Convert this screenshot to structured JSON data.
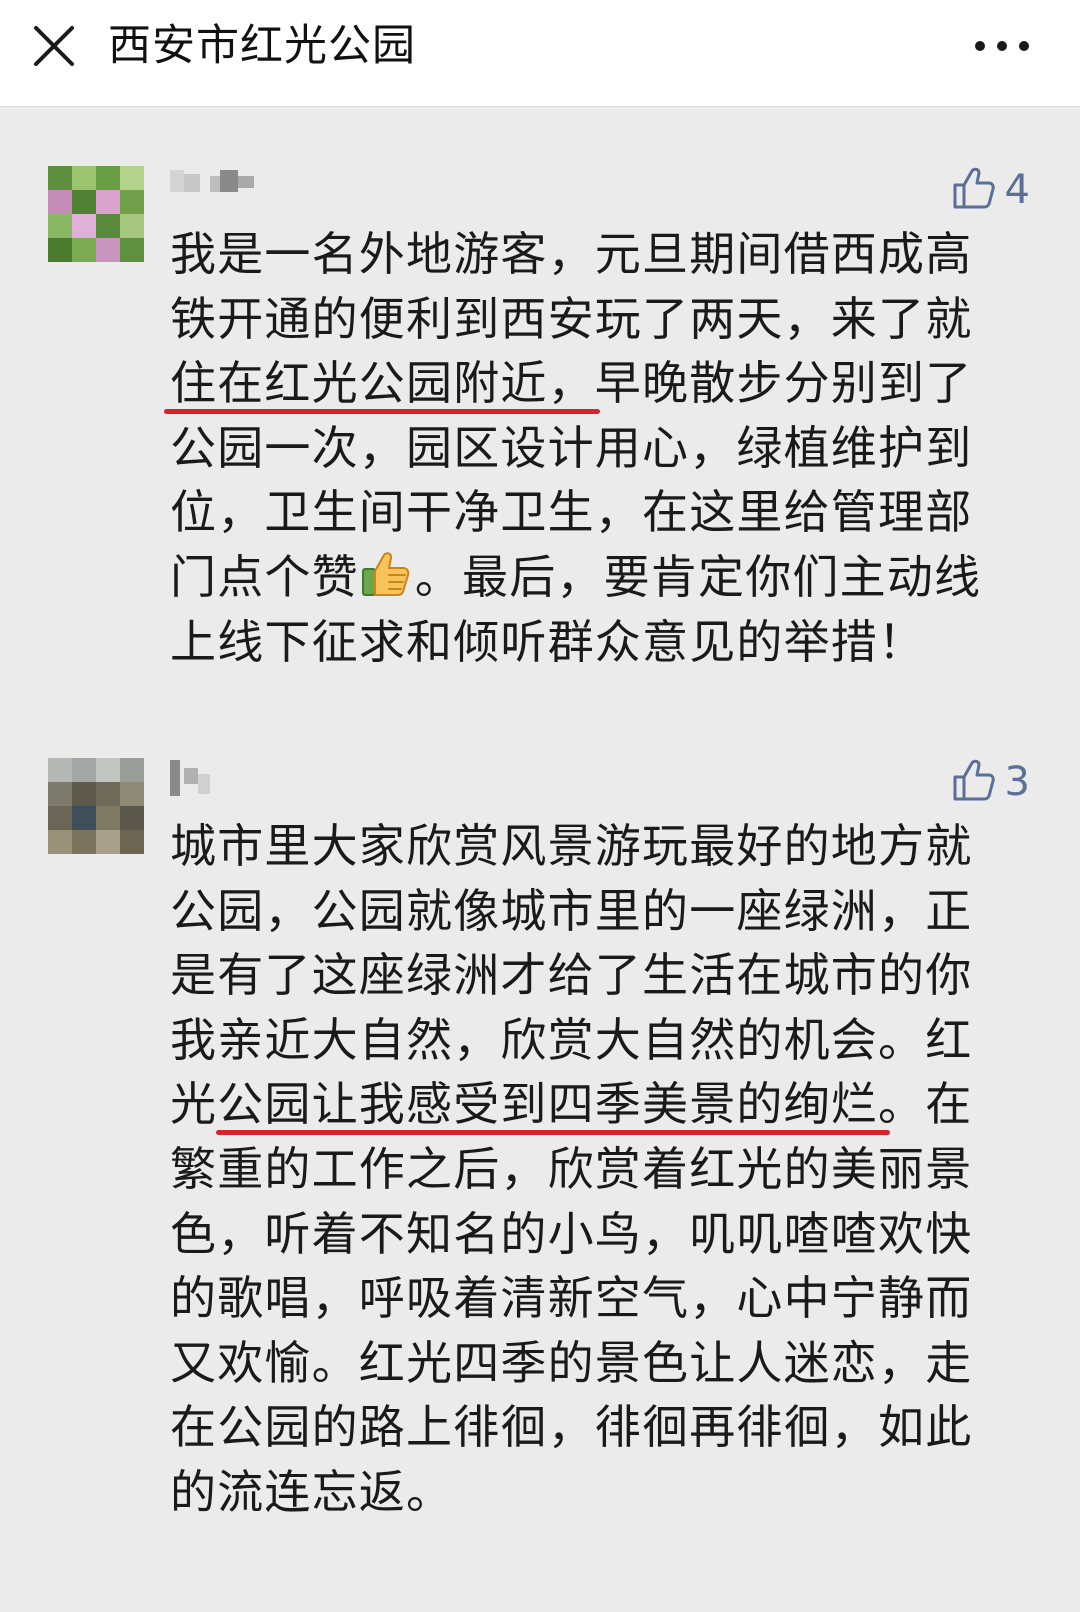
{
  "nav": {
    "title": "西安市红光公园",
    "close_icon": "close-icon",
    "more_icon": "more-icon"
  },
  "comments": [
    {
      "avatar_icon": "avatar",
      "likes": "4",
      "text": "我是一名外地游客，元旦期间借西成高\n铁开通的便利到西安玩了两天，来了就\n住在红光公园附近，早晚散步分别到了\n公园一次，园区设计用心，绿植维护到\n位，卫生间干净卫生，在这里给管理部\n门点个赞",
      "text_after_emoji": "。最后，要肯定你们主动线\n上线下征求和倾听群众意见的举措！",
      "emoji": "thumbs-up-emoji",
      "highlight": "住在红光公园附近，"
    },
    {
      "avatar_icon": "avatar",
      "likes": "3",
      "text": "城市里大家欣赏风景游玩最好的地方就\n公园，公园就像城市里的一座绿洲，正\n是有了这座绿洲才给了生活在城市的你\n我亲近大自然，欣赏大自然的机会。红\n光公园让我感受到四季美景的绚烂。在\n繁重的工作之后，欣赏着红光的美丽景\n色，听着不知名的小鸟，叽叽喳喳欢快\n的歌唱，呼吸着清新空气，心中宁静而\n又欢愉。红光四季的景色让人迷恋，走\n在公园的路上徘徊，徘徊再徘徊，如此\n的流连忘返。",
      "highlight": "公园让我感受到四季美景的绚烂"
    }
  ],
  "colors": {
    "accent": "#5b6f97",
    "underline": "#d6232a",
    "background": "#ebebeb"
  }
}
